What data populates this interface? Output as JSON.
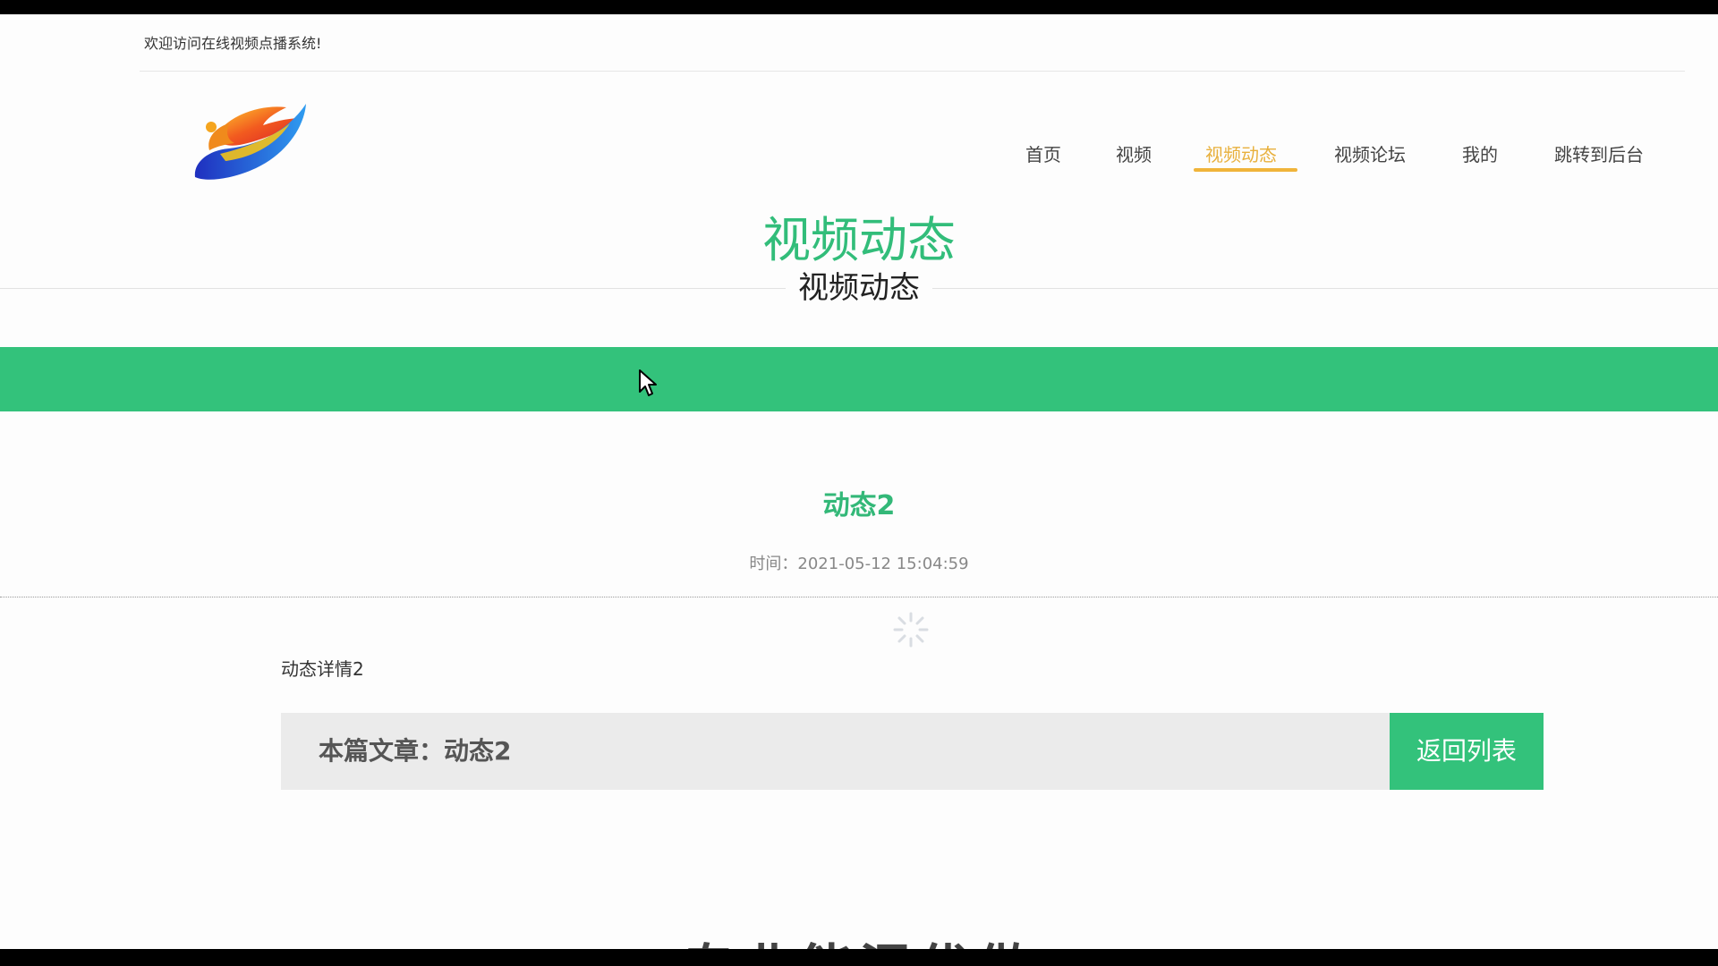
{
  "header": {
    "welcome": "欢迎访问在线视频点播系统!"
  },
  "nav": {
    "items": [
      {
        "label": "首页",
        "active": false
      },
      {
        "label": "视频",
        "active": false
      },
      {
        "label": "视频动态",
        "active": true
      },
      {
        "label": "视频论坛",
        "active": false
      },
      {
        "label": "我的",
        "active": false
      },
      {
        "label": "跳转到后台",
        "active": false
      }
    ]
  },
  "banner": {
    "title_large": "视频动态",
    "title_small": "视频动态"
  },
  "article": {
    "title": "动态2",
    "time": "时间：2021-05-12 15:04:59",
    "content": "动态详情2",
    "footer_label": "本篇文章：动态2",
    "back_label": "返回列表"
  },
  "below_fold": {
    "partial_heading": "专业能混优做"
  },
  "colors": {
    "accent_green": "#33c27b",
    "nav_active": "#e8b03c",
    "title_green": "#32bd7a"
  },
  "icons": {
    "logo": "dragon-logo",
    "loading": "spinner-icon",
    "pointer": "mouse-cursor-icon"
  }
}
